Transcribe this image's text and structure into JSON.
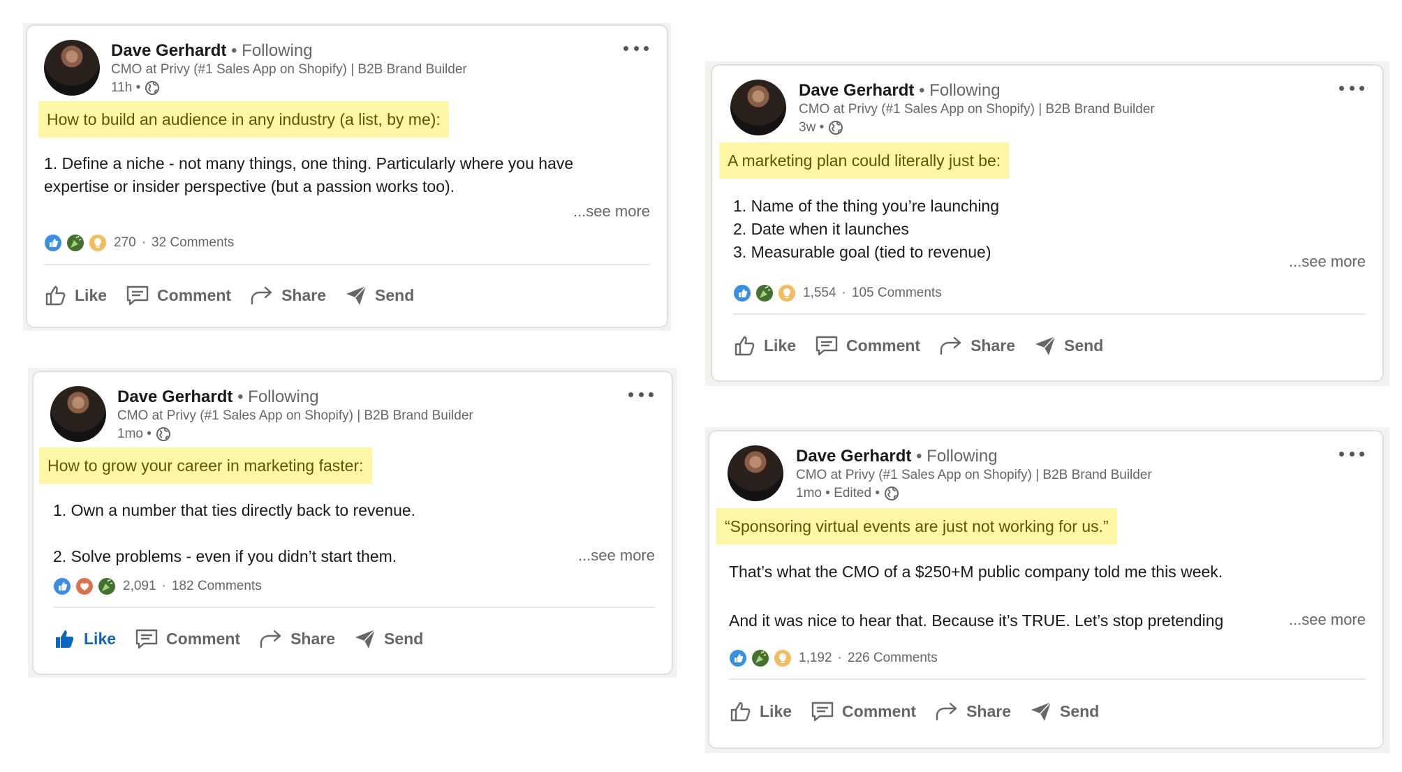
{
  "posts": [
    {
      "author": "Dave Gerhardt",
      "following": "Following",
      "headline": "CMO at Privy (#1 Sales App on Shopify) | B2B Brand Builder",
      "time": "11h •",
      "highlight": "How to build an audience in any industry (a list, by me):",
      "body": [
        "1. Define a niche - not many things, one thing. Particularly where you have",
        "expertise or insider perspective (but a passion works too)."
      ],
      "see_more": "...see more",
      "reaction_count": "270",
      "comments": "32 Comments",
      "reactions": [
        "like-icon",
        "celebrate-icon",
        "insightful-icon"
      ],
      "actions": {
        "like": "Like",
        "comment": "Comment",
        "share": "Share",
        "send": "Send"
      },
      "liked": false
    },
    {
      "author": "Dave Gerhardt",
      "following": "Following",
      "headline": "CMO at Privy (#1 Sales App on Shopify) | B2B Brand Builder",
      "time": "3w •",
      "highlight": "A marketing plan could literally just be:",
      "body": [
        "1. Name of the thing you’re launching",
        "2. Date when it launches",
        "3. Measurable goal (tied to revenue)"
      ],
      "see_more": "...see more",
      "reaction_count": "1,554",
      "comments": "105 Comments",
      "reactions": [
        "like-icon",
        "celebrate-icon",
        "insightful-icon"
      ],
      "actions": {
        "like": "Like",
        "comment": "Comment",
        "share": "Share",
        "send": "Send"
      },
      "liked": false
    },
    {
      "author": "Dave Gerhardt",
      "following": "Following",
      "headline": "CMO at Privy (#1 Sales App on Shopify) | B2B Brand Builder",
      "time": "1mo •",
      "highlight": "How to grow your career in marketing faster:",
      "body": [
        "1. Own a number that ties directly back to revenue.",
        "",
        "2. Solve problems - even if you didn’t start them."
      ],
      "see_more": "...see more",
      "reaction_count": "2,091",
      "comments": "182 Comments",
      "reactions": [
        "like-icon",
        "love-icon",
        "celebrate-icon"
      ],
      "actions": {
        "like": "Like",
        "comment": "Comment",
        "share": "Share",
        "send": "Send"
      },
      "liked": true
    },
    {
      "author": "Dave Gerhardt",
      "following": "Following",
      "headline": "CMO at Privy (#1 Sales App on Shopify) | B2B Brand Builder",
      "time": "1mo • Edited •",
      "highlight": "“Sponsoring virtual events are just not working for us.”",
      "body": [
        "That’s what the CMO of a $250+M public company told me this week.",
        "",
        "And it was nice to hear that. Because it’s TRUE. Let’s stop pretending"
      ],
      "see_more": "...see more",
      "reaction_count": "1,192",
      "comments": "226 Comments",
      "reactions": [
        "like-icon",
        "celebrate-icon",
        "insightful-icon"
      ],
      "actions": {
        "like": "Like",
        "comment": "Comment",
        "share": "Share",
        "send": "Send"
      },
      "liked": false
    }
  ],
  "colors": {
    "highlight": "#fff7a6",
    "link_blue": "#0a66c2",
    "muted": "#666666"
  }
}
